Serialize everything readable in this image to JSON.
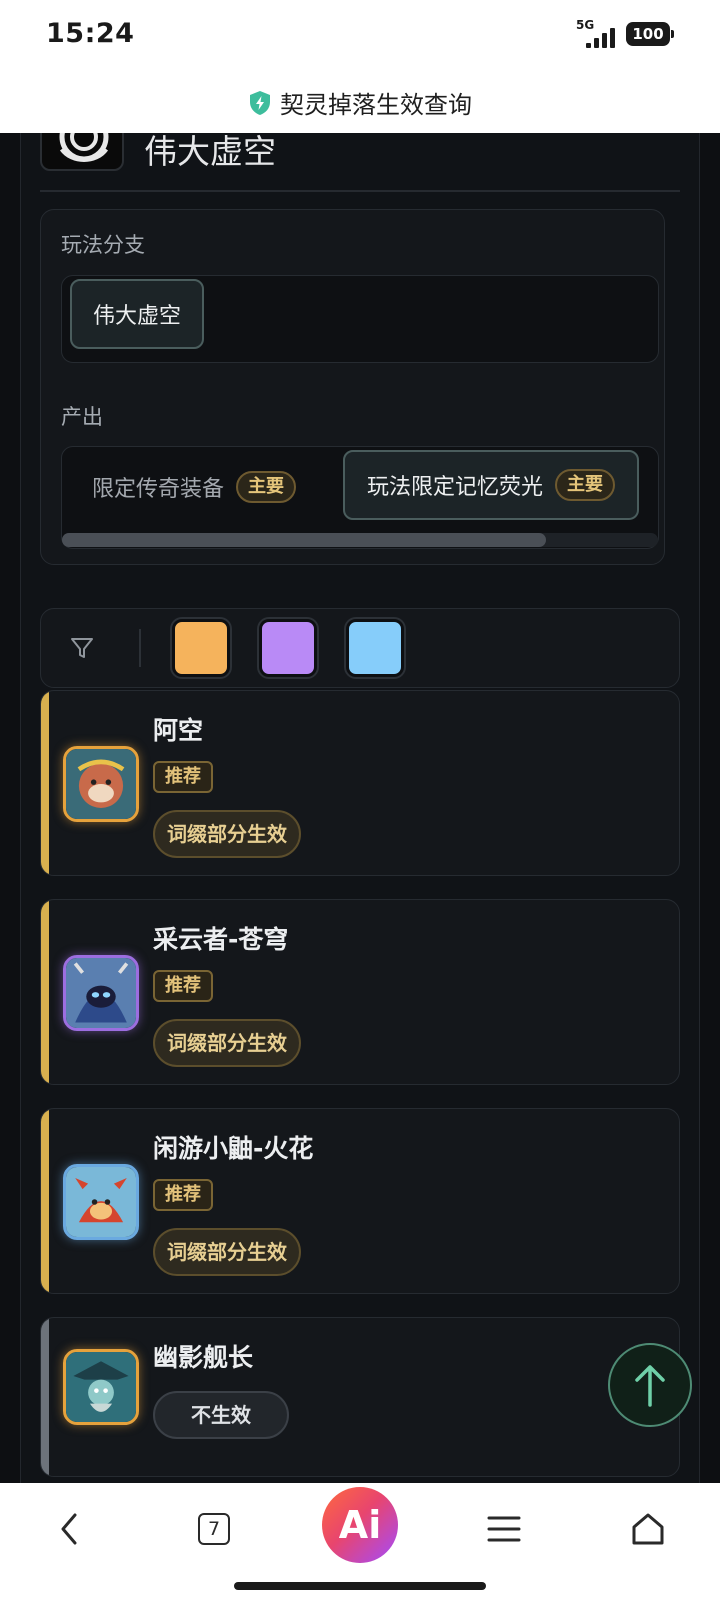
{
  "status_bar": {
    "time": "15:24",
    "network": "5G",
    "battery": "100"
  },
  "header": {
    "title": "契灵掉落生效查询",
    "shield_icon": "shield-bolt-icon",
    "shield_color": "#3dbd9c"
  },
  "dungeon": {
    "name": "伟大虚空"
  },
  "branch": {
    "label": "玩法分支",
    "chips": [
      "伟大虚空"
    ]
  },
  "output": {
    "label": "产出",
    "items": [
      {
        "name": "限定传奇装备",
        "badge": "主要",
        "selected": false
      },
      {
        "name": "玩法限定记忆荧光",
        "badge": "主要",
        "selected": true
      }
    ]
  },
  "filter": {
    "icon": "funnel-icon",
    "swatches": [
      {
        "name": "orange",
        "color": "#f5b35c"
      },
      {
        "name": "purple",
        "color": "#b98af6"
      },
      {
        "name": "blue",
        "color": "#86cdfa"
      }
    ]
  },
  "creatures": [
    {
      "name": "阿空",
      "tag": "推荐",
      "status": "词缀部分生效",
      "accent": "#d8b04f",
      "frame": "#e6a23c"
    },
    {
      "name": "采云者-苍穹",
      "tag": "推荐",
      "status": "词缀部分生效",
      "accent": "#d8b04f",
      "frame": "#9c6ee0"
    },
    {
      "name": "闲游小鼬-火花",
      "tag": "推荐",
      "status": "词缀部分生效",
      "accent": "#d8b04f",
      "frame": "#6aa9e0"
    },
    {
      "name": "幽影舰长",
      "tag": "",
      "status": "不生效",
      "accent": "#6d737b",
      "frame": "#e6a23c"
    }
  ],
  "scroll_top_icon": "arrow-up-icon",
  "bottom_nav": {
    "back_icon": "chevron-left-icon",
    "tab_count": "7",
    "ai_label": "Ai",
    "menu_icon": "menu-icon",
    "home_icon": "home-icon"
  }
}
